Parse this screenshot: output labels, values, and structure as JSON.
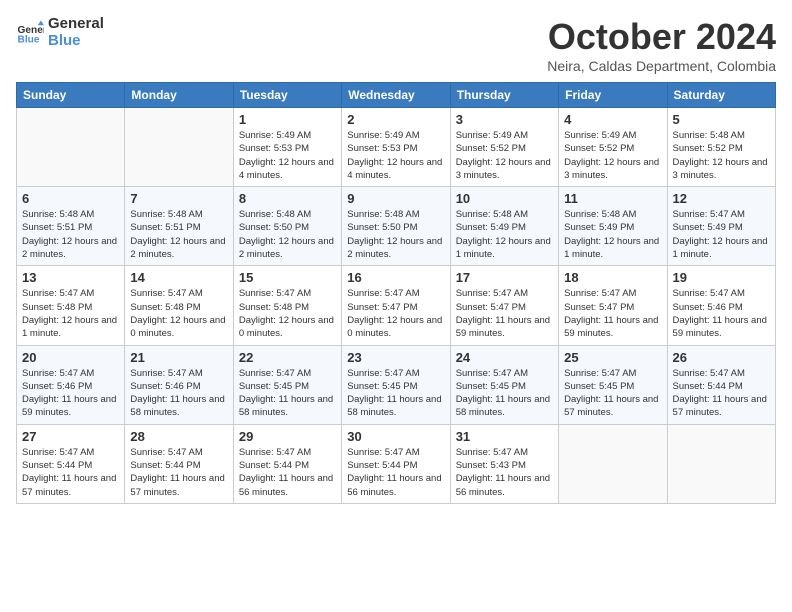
{
  "logo": {
    "line1": "General",
    "line2": "Blue"
  },
  "title": "October 2024",
  "subtitle": "Neira, Caldas Department, Colombia",
  "days_header": [
    "Sunday",
    "Monday",
    "Tuesday",
    "Wednesday",
    "Thursday",
    "Friday",
    "Saturday"
  ],
  "weeks": [
    [
      {
        "day": "",
        "info": ""
      },
      {
        "day": "",
        "info": ""
      },
      {
        "day": "1",
        "info": "Sunrise: 5:49 AM\nSunset: 5:53 PM\nDaylight: 12 hours and 4 minutes."
      },
      {
        "day": "2",
        "info": "Sunrise: 5:49 AM\nSunset: 5:53 PM\nDaylight: 12 hours and 4 minutes."
      },
      {
        "day": "3",
        "info": "Sunrise: 5:49 AM\nSunset: 5:52 PM\nDaylight: 12 hours and 3 minutes."
      },
      {
        "day": "4",
        "info": "Sunrise: 5:49 AM\nSunset: 5:52 PM\nDaylight: 12 hours and 3 minutes."
      },
      {
        "day": "5",
        "info": "Sunrise: 5:48 AM\nSunset: 5:52 PM\nDaylight: 12 hours and 3 minutes."
      }
    ],
    [
      {
        "day": "6",
        "info": "Sunrise: 5:48 AM\nSunset: 5:51 PM\nDaylight: 12 hours and 2 minutes."
      },
      {
        "day": "7",
        "info": "Sunrise: 5:48 AM\nSunset: 5:51 PM\nDaylight: 12 hours and 2 minutes."
      },
      {
        "day": "8",
        "info": "Sunrise: 5:48 AM\nSunset: 5:50 PM\nDaylight: 12 hours and 2 minutes."
      },
      {
        "day": "9",
        "info": "Sunrise: 5:48 AM\nSunset: 5:50 PM\nDaylight: 12 hours and 2 minutes."
      },
      {
        "day": "10",
        "info": "Sunrise: 5:48 AM\nSunset: 5:49 PM\nDaylight: 12 hours and 1 minute."
      },
      {
        "day": "11",
        "info": "Sunrise: 5:48 AM\nSunset: 5:49 PM\nDaylight: 12 hours and 1 minute."
      },
      {
        "day": "12",
        "info": "Sunrise: 5:47 AM\nSunset: 5:49 PM\nDaylight: 12 hours and 1 minute."
      }
    ],
    [
      {
        "day": "13",
        "info": "Sunrise: 5:47 AM\nSunset: 5:48 PM\nDaylight: 12 hours and 1 minute."
      },
      {
        "day": "14",
        "info": "Sunrise: 5:47 AM\nSunset: 5:48 PM\nDaylight: 12 hours and 0 minutes."
      },
      {
        "day": "15",
        "info": "Sunrise: 5:47 AM\nSunset: 5:48 PM\nDaylight: 12 hours and 0 minutes."
      },
      {
        "day": "16",
        "info": "Sunrise: 5:47 AM\nSunset: 5:47 PM\nDaylight: 12 hours and 0 minutes."
      },
      {
        "day": "17",
        "info": "Sunrise: 5:47 AM\nSunset: 5:47 PM\nDaylight: 11 hours and 59 minutes."
      },
      {
        "day": "18",
        "info": "Sunrise: 5:47 AM\nSunset: 5:47 PM\nDaylight: 11 hours and 59 minutes."
      },
      {
        "day": "19",
        "info": "Sunrise: 5:47 AM\nSunset: 5:46 PM\nDaylight: 11 hours and 59 minutes."
      }
    ],
    [
      {
        "day": "20",
        "info": "Sunrise: 5:47 AM\nSunset: 5:46 PM\nDaylight: 11 hours and 59 minutes."
      },
      {
        "day": "21",
        "info": "Sunrise: 5:47 AM\nSunset: 5:46 PM\nDaylight: 11 hours and 58 minutes."
      },
      {
        "day": "22",
        "info": "Sunrise: 5:47 AM\nSunset: 5:45 PM\nDaylight: 11 hours and 58 minutes."
      },
      {
        "day": "23",
        "info": "Sunrise: 5:47 AM\nSunset: 5:45 PM\nDaylight: 11 hours and 58 minutes."
      },
      {
        "day": "24",
        "info": "Sunrise: 5:47 AM\nSunset: 5:45 PM\nDaylight: 11 hours and 58 minutes."
      },
      {
        "day": "25",
        "info": "Sunrise: 5:47 AM\nSunset: 5:45 PM\nDaylight: 11 hours and 57 minutes."
      },
      {
        "day": "26",
        "info": "Sunrise: 5:47 AM\nSunset: 5:44 PM\nDaylight: 11 hours and 57 minutes."
      }
    ],
    [
      {
        "day": "27",
        "info": "Sunrise: 5:47 AM\nSunset: 5:44 PM\nDaylight: 11 hours and 57 minutes."
      },
      {
        "day": "28",
        "info": "Sunrise: 5:47 AM\nSunset: 5:44 PM\nDaylight: 11 hours and 57 minutes."
      },
      {
        "day": "29",
        "info": "Sunrise: 5:47 AM\nSunset: 5:44 PM\nDaylight: 11 hours and 56 minutes."
      },
      {
        "day": "30",
        "info": "Sunrise: 5:47 AM\nSunset: 5:44 PM\nDaylight: 11 hours and 56 minutes."
      },
      {
        "day": "31",
        "info": "Sunrise: 5:47 AM\nSunset: 5:43 PM\nDaylight: 11 hours and 56 minutes."
      },
      {
        "day": "",
        "info": ""
      },
      {
        "day": "",
        "info": ""
      }
    ]
  ]
}
